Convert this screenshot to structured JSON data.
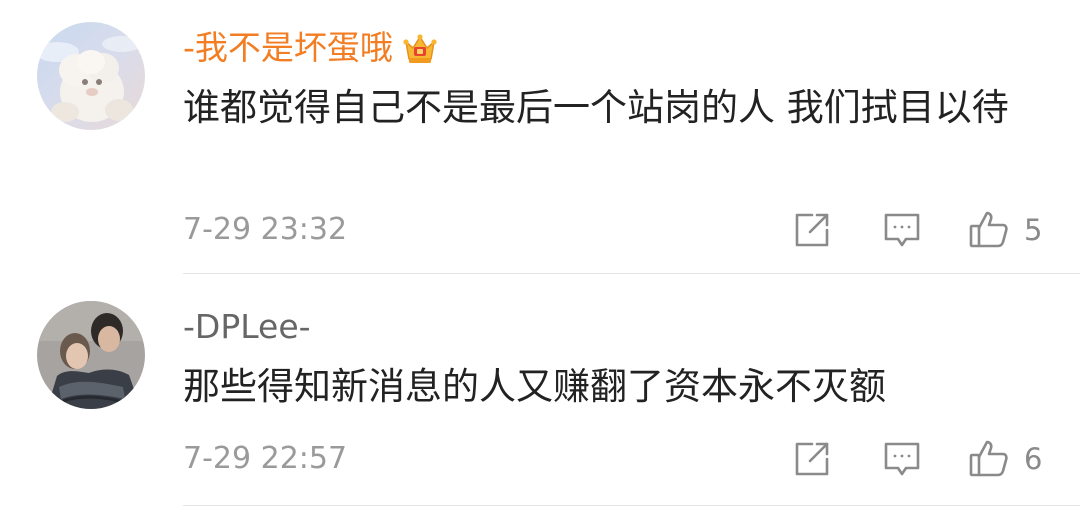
{
  "comments": [
    {
      "username": "-我不是坏蛋哦",
      "text": "谁都觉得自己不是最后一个站岗的人 我们拭目以待",
      "time": "7-29 23:32",
      "likes": "5",
      "avatar_icon": "lamb-plush-avatar",
      "badge_icon": "crown-vip-icon",
      "name_color": "#f27d22"
    },
    {
      "username": "-DPLee-",
      "text": "那些得知新消息的人又赚翻了资本永不灭额",
      "time": "7-29 22:57",
      "likes": "6",
      "avatar_icon": "couple-photo-avatar",
      "name_color": "#666666"
    }
  ],
  "actions": {
    "share_icon": "share-icon",
    "reply_icon": "reply-icon",
    "like_icon": "thumbs-up-icon"
  }
}
